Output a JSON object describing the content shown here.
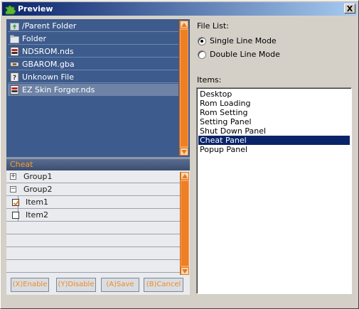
{
  "window": {
    "title": "Preview",
    "close_glyph": "X"
  },
  "file_browser": {
    "items": [
      {
        "label": "/Parent Folder",
        "icon": "parent-folder-icon"
      },
      {
        "label": "Folder",
        "icon": "folder-icon"
      },
      {
        "label": "NDSROM.nds",
        "icon": "nds-rom-icon"
      },
      {
        "label": "GBAROM.gba",
        "icon": "gba-rom-icon"
      },
      {
        "label": "Unknown File",
        "icon": "unknown-file-icon"
      },
      {
        "label": "EZ Skin Forger.nds",
        "icon": "nds-rom-icon",
        "selected": true
      }
    ]
  },
  "cheat": {
    "header": "Cheat",
    "rows": [
      {
        "label": "Group1",
        "type": "group",
        "expander": "+"
      },
      {
        "label": "Group2",
        "type": "group",
        "expander": "−"
      },
      {
        "label": "Item1",
        "type": "item",
        "checked": true
      },
      {
        "label": "Item2",
        "type": "item",
        "checked": false
      }
    ],
    "buttons": {
      "enable": "(X)Enable",
      "disable": "(Y)Disable",
      "save": "(A)Save",
      "cancel": "(B)Cancel"
    }
  },
  "options": {
    "file_list_label": "File List:",
    "single_line": "Single Line Mode",
    "double_line": "Double Line Mode",
    "selected_mode": "Single Line Mode",
    "items_label": "Items:",
    "items": [
      "Desktop",
      "Rom Loading",
      "Rom Setting",
      "Setting Panel",
      "Shut Down Panel",
      "Cheat Panel",
      "Popup Panel"
    ],
    "selected_item": "Cheat Panel"
  },
  "colors": {
    "accent_orange": "#f08a1c",
    "selection_blue": "#0a246a"
  }
}
